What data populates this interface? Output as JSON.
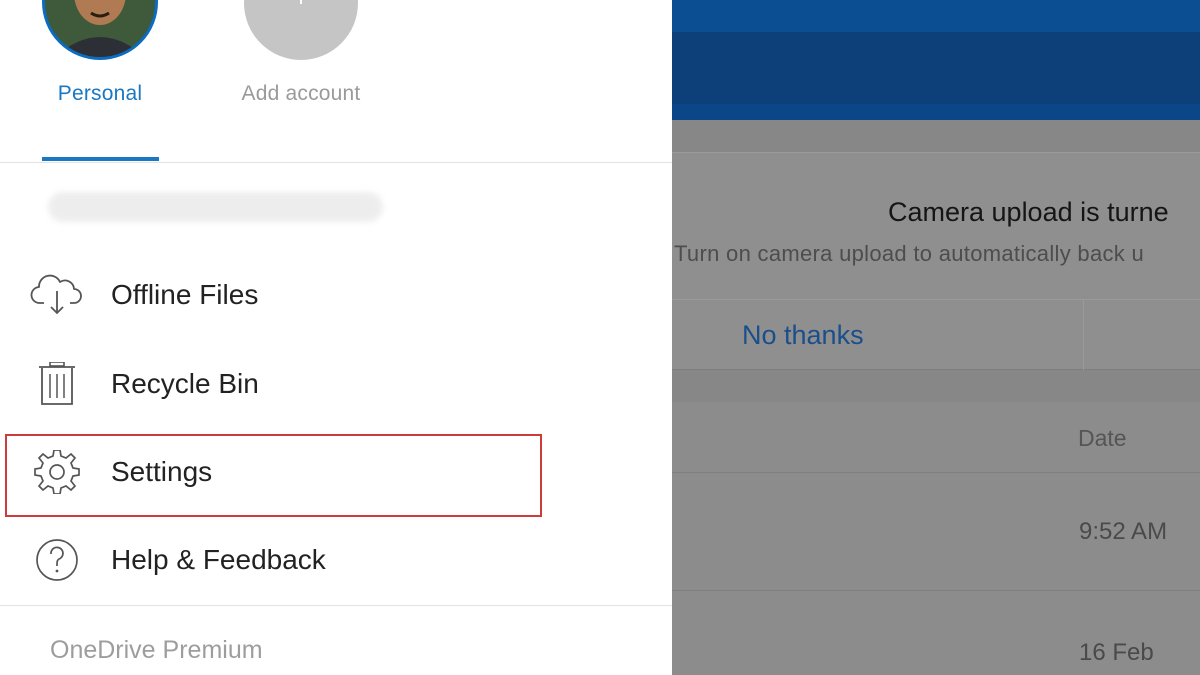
{
  "accounts": [
    {
      "label": "Personal",
      "selected": true
    },
    {
      "label": "Add account",
      "selected": false
    }
  ],
  "menu": {
    "items": [
      {
        "label": "Offline Files",
        "icon": "cloud-download-icon"
      },
      {
        "label": "Recycle Bin",
        "icon": "trash-icon"
      },
      {
        "label": "Settings",
        "icon": "gear-icon",
        "highlighted": true
      },
      {
        "label": "Help & Feedback",
        "icon": "help-circle-icon"
      }
    ],
    "premium_label": "OneDrive Premium"
  },
  "camera_card": {
    "title": "Camera upload is turne",
    "subtitle": "Turn on camera upload to automatically back u",
    "dismiss_label": "No thanks"
  },
  "file_list": {
    "column_header": "Date",
    "dates": [
      "9:52 AM",
      "16 Feb"
    ]
  },
  "colors": {
    "accent": "#1a78c2",
    "highlight": "#cf3b3b",
    "appbar": "#0d3f78",
    "overlay": "#878787"
  }
}
